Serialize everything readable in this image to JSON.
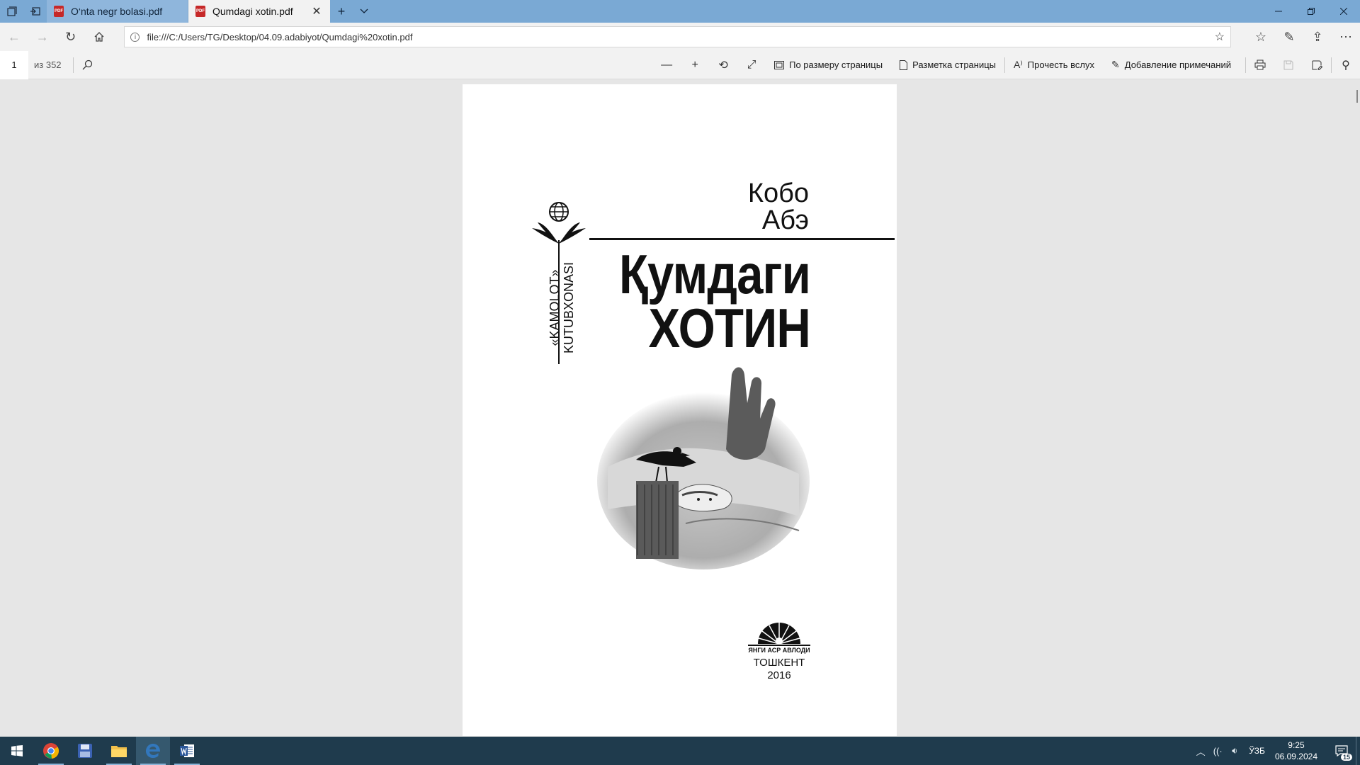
{
  "browser": {
    "tabs": [
      {
        "title": "O‘nta negr bolasi.pdf",
        "active": false
      },
      {
        "title": "Qumdagi xotin.pdf",
        "active": true
      }
    ],
    "address": "file:///C:/Users/TG/Desktop/04.09.adabiyot/Qumdagi%20xotin.pdf"
  },
  "pdf_toolbar": {
    "page_current": "1",
    "page_total": "из 352",
    "fit_page": "По размеру страницы",
    "page_layout": "Разметка страницы",
    "read_aloud": "Прочесть вслух",
    "add_notes": "Добавление примечаний"
  },
  "book": {
    "author_line1": "Кобо",
    "author_line2": "Абэ",
    "title_line1": "Қумдаги",
    "title_line2": "хотин",
    "series_line1": "«KAMOLOT»",
    "series_line2": "KUTUBXONASI",
    "publisher": "ЯНГИ АСР АВЛОДИ",
    "city": "ТОШКЕНТ",
    "year": "2016"
  },
  "taskbar": {
    "apps": [
      "chrome-icon",
      "save-icon",
      "file-explorer-icon",
      "edge-icon",
      "word-icon"
    ],
    "language": "ЎЗБ",
    "time": "9:25",
    "date": "06.09.2024",
    "notifications": "15"
  },
  "colors": {
    "titlebar": "#7aa9d4",
    "taskbar": "#1f3b4d",
    "pdf_icon": "#c62828"
  }
}
